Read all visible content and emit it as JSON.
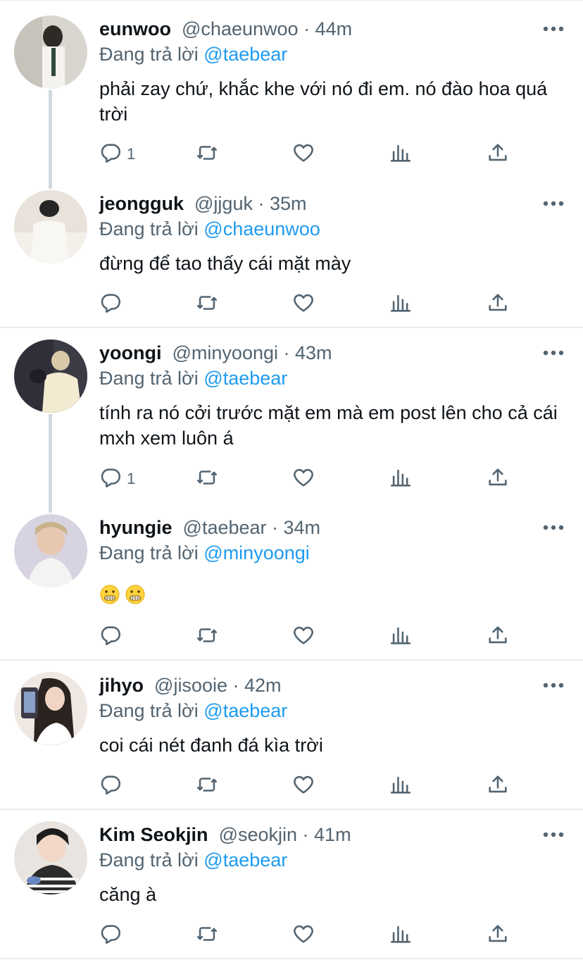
{
  "reply_prefix": "Đang trả lời",
  "tweets": [
    {
      "name": "eunwoo",
      "handle": "@chaeunwoo",
      "time": "· 44m",
      "reply_to": "@taebear",
      "text": "phải zay chứ, khắc khe với nó đi em. nó đào hoa quá trời",
      "reply_count": "1",
      "avatar_colors": [
        "#d9d6cf",
        "#3a3a3a"
      ]
    },
    {
      "name": "jeongguk",
      "handle": "@jjguk",
      "time": "· 35m",
      "reply_to": "@chaeunwoo",
      "text": "đừng để tao thấy cái mặt mày",
      "reply_count": "",
      "avatar_colors": [
        "#e8e2da",
        "#2b2b2b"
      ]
    },
    {
      "name": "yoongi",
      "handle": "@minyoongi",
      "time": "· 43m",
      "reply_to": "@taebear",
      "text": "tính ra nó cởi trước mặt em mà em post lên cho cả cái mxh xem luôn á",
      "reply_count": "1",
      "avatar_colors": [
        "#2f2f3a",
        "#f3ead2"
      ]
    },
    {
      "name": "hyungie",
      "handle": "@taebear",
      "time": "· 34m",
      "reply_to": "@minyoongi",
      "text": "",
      "reply_count": "",
      "avatar_colors": [
        "#d8d3e0",
        "#e7c7b0"
      ],
      "emoji": [
        "grimacing-face-emoji",
        "grimacing-face-emoji"
      ]
    },
    {
      "name": "jihyo",
      "handle": "@jisooie",
      "time": "· 42m",
      "reply_to": "@taebear",
      "text": "coi cái nét đanh đá kìa trời",
      "reply_count": "",
      "avatar_colors": [
        "#efe7e2",
        "#2a2320"
      ]
    },
    {
      "name": "Kim Seokjin",
      "handle": "@seokjin",
      "time": "· 41m",
      "reply_to": "@taebear",
      "text": "căng à",
      "reply_count": "",
      "avatar_colors": [
        "#e9e4df",
        "#1d1d1d"
      ]
    }
  ],
  "icons": [
    "reply-icon",
    "retweet-icon",
    "like-icon",
    "analytics-icon",
    "share-icon",
    "more-icon"
  ],
  "colors": {
    "accent": "#1d9bf0",
    "muted": "#536471",
    "text": "#0f1419",
    "divider": "#e6ecf0"
  }
}
